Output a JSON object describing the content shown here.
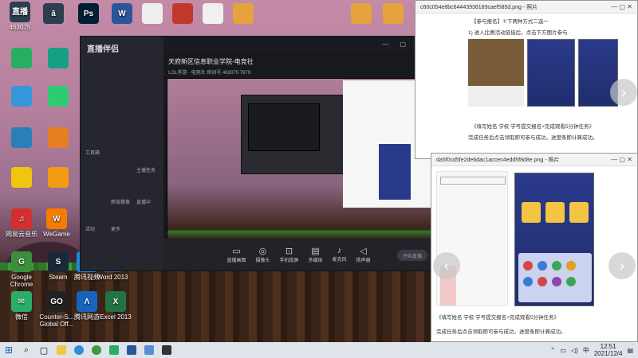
{
  "desktop": {
    "icons": [
      {
        "label": "",
        "text": "ā",
        "color": "#2c3e50"
      },
      {
        "label": "",
        "text": "Ps",
        "color": "#001e36"
      },
      {
        "label": "",
        "text": "W",
        "color": "#2b579a"
      },
      {
        "label": "",
        "text": "",
        "color": "#eee"
      },
      {
        "label": "",
        "text": "",
        "color": "#c0392b"
      },
      {
        "label": "",
        "text": "",
        "color": "#f0f0f0"
      },
      {
        "label": "",
        "text": "",
        "color": "#e6a23c"
      },
      {
        "label": "",
        "text": "",
        "color": "#e6a23c"
      },
      {
        "label": "",
        "text": "",
        "color": "#e6a23c"
      }
    ],
    "bottom_icons": [
      {
        "label": "Google Chrome",
        "text": "G",
        "color": "#3c8d3c"
      },
      {
        "label": "Steam",
        "text": "S",
        "color": "#1b2838"
      },
      {
        "label": "腾讯视频",
        "text": "▶",
        "color": "#1e88e5"
      },
      {
        "label": "Word 2013",
        "text": "W",
        "color": "#2b579a"
      },
      {
        "label": "微信",
        "text": "✉",
        "color": "#2aae67"
      },
      {
        "label": "Counter-S... Global Off...",
        "text": "GO",
        "color": "#222"
      },
      {
        "label": "腾讯网游",
        "text": "Λ",
        "color": "#1565c0"
      },
      {
        "label": "Excel 2013",
        "text": "X",
        "color": "#217346"
      },
      {
        "label": "网易云音乐",
        "text": "♫",
        "color": "#d32f2f"
      },
      {
        "label": "WeGame",
        "text": "W",
        "color": "#f57c00"
      }
    ],
    "top_left_label": "直播",
    "top_left_sub": "463075"
  },
  "stream_window": {
    "app_name": "直播伴侣",
    "title": "天府新区信息职业学院-电竞社",
    "subtitle": "LOL手游 · 电竞社   房间号 463075   7879",
    "side_items": [
      "工具箱",
      "主播任务",
      "直播中",
      "活动",
      "新版赛事",
      "更多"
    ],
    "bottom_buttons": [
      {
        "icon": "▭",
        "label": "直播画面"
      },
      {
        "icon": "◎",
        "label": "摄像头"
      },
      {
        "icon": "⊡",
        "label": "手机投屏"
      },
      {
        "icon": "▤",
        "label": "多媒体"
      },
      {
        "icon": "♪",
        "label": "麦克风"
      },
      {
        "icon": "◁",
        "label": "扬声器"
      }
    ],
    "start_label": "开始直播"
  },
  "viewer1": {
    "filename": "c60c054e8bc64443938189caef585d.png - 照片",
    "lines": [
      "【参与报名】①下两种方式二选一",
      "1) 进入比赛活动链接后，点击下方图片参与",
      "《填写姓名  学校  学号提交报名+完成观看5分钟任务》",
      "完成任务后点击领取即可参与成功，进度条即计算成功。"
    ]
  },
  "viewer2": {
    "filename": "da5f0cd5fe2de6dac1accec4edd5f8d8e.png - 照片",
    "lines": [
      "《填写姓名  学校  学号提交报名+完成观看5分钟任务》",
      "完成任务后点击领取即可参与成功，进度条即计算成功。"
    ]
  },
  "taskbar": {
    "time": "12:51",
    "date": "2021/12/4",
    "ime": "中"
  },
  "colors": {
    "taskbar": "#dfe3ea",
    "stream_bg": "#1f2026",
    "accent_red": "#e04040"
  }
}
